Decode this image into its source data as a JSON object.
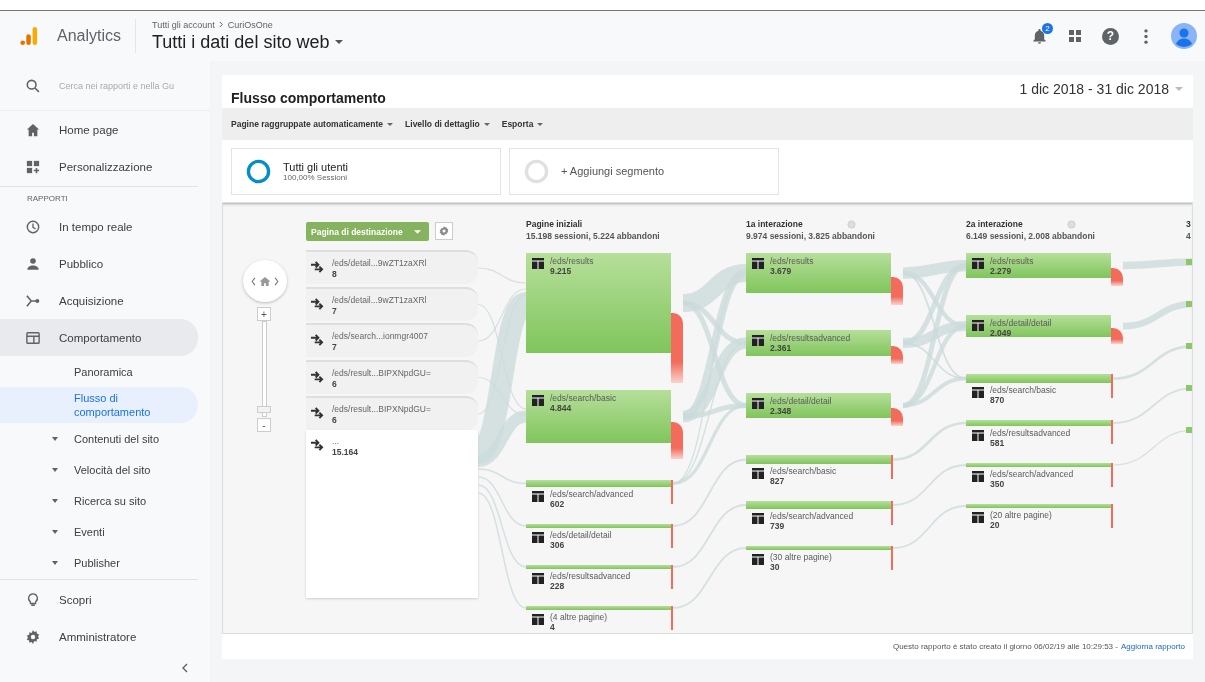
{
  "header": {
    "product": "Analytics",
    "breadcrumb": [
      "Tutti gli account",
      "CuriOsOne"
    ],
    "property": "Tutti i dati del sito web",
    "notifications": "2",
    "help": "?"
  },
  "sidebar": {
    "search_placeholder": "Cerca nei rapporti e nella Gu",
    "top_items": [
      {
        "label": "Home page"
      },
      {
        "label": "Personalizzazione"
      }
    ],
    "section": "RAPPORTI",
    "reports": [
      {
        "label": "In tempo reale",
        "expanded": false
      },
      {
        "label": "Pubblico",
        "expanded": false
      },
      {
        "label": "Acquisizione",
        "expanded": false
      },
      {
        "label": "Comportamento",
        "expanded": true,
        "children": [
          {
            "label": "Panoramica",
            "selected": false,
            "has_children": false
          },
          {
            "label": "Flusso di comportamento",
            "selected": true,
            "has_children": false
          },
          {
            "label": "Contenuti del sito",
            "selected": false,
            "has_children": true
          },
          {
            "label": "Velocità del sito",
            "selected": false,
            "has_children": true
          },
          {
            "label": "Ricerca su sito",
            "selected": false,
            "has_children": true
          },
          {
            "label": "Eventi",
            "selected": false,
            "has_children": true
          },
          {
            "label": "Publisher",
            "selected": false,
            "has_children": true
          }
        ]
      }
    ],
    "bottom_items": [
      {
        "label": "Scopri"
      },
      {
        "label": "Amministratore"
      }
    ]
  },
  "report": {
    "title": "Flusso comportamento",
    "date_range": "1 dic 2018 - 31 dic 2018",
    "toolbar": [
      "Pagine raggruppate automaticamente",
      "Livello di dettaglio",
      "Esporta"
    ],
    "segments": [
      {
        "kind": "segment",
        "title": "Tutti gli utenti",
        "subtitle": "100,00% Sessioni"
      },
      {
        "kind": "add",
        "title": "+ Aggiungi segmento"
      }
    ]
  },
  "flow": {
    "dimension": "Pagina di destinazione",
    "zoom": {
      "zoom_in": "+",
      "zoom_out": "-"
    },
    "landing_pages": [
      {
        "kind": "page",
        "label": "/eds/detail...9wZT1zaXRl",
        "count": "8"
      },
      {
        "kind": "page",
        "label": "/eds/detail...9wZT1zaXRl",
        "count": "7"
      },
      {
        "kind": "page",
        "label": "/eds/search...ionmgr4007",
        "count": "7"
      },
      {
        "kind": "page",
        "label": "/eds/result...BIPXNpdGU=",
        "count": "6"
      },
      {
        "kind": "page",
        "label": "/eds/result...BIPXNpdGU=",
        "count": "6"
      },
      {
        "kind": "more",
        "label": "...",
        "count": "15.164"
      }
    ],
    "columns": [
      {
        "title": "Pagine iniziali",
        "summary": "15.198 sessioni, 5.224 abbandoni",
        "info_icon": false,
        "nodes": [
          {
            "label": "/eds/results",
            "value": "9.215"
          },
          {
            "label": "/eds/search/basic",
            "value": "4.844"
          },
          {
            "label": "/eds/search/advanced",
            "value": "602"
          },
          {
            "label": "/eds/detail/detail",
            "value": "306"
          },
          {
            "label": "/eds/resultsadvanced",
            "value": "228"
          },
          {
            "label": "(4 altre pagine)",
            "value": "4"
          }
        ]
      },
      {
        "title": "1a interazione",
        "summary": "9.974 sessioni, 3.825 abbandoni",
        "info_icon": true,
        "nodes": [
          {
            "label": "/eds/results",
            "value": "3.679"
          },
          {
            "label": "/eds/resultsadvanced",
            "value": "2.361"
          },
          {
            "label": "/eds/detail/detail",
            "value": "2.348"
          },
          {
            "label": "/eds/search/basic",
            "value": "827"
          },
          {
            "label": "/eds/search/advanced",
            "value": "739"
          },
          {
            "label": "(30 altre pagine)",
            "value": "30"
          }
        ]
      },
      {
        "title": "2a interazione",
        "summary": "6.149 sessioni, 2.008 abbandoni",
        "info_icon": true,
        "nodes": [
          {
            "label": "/eds/results",
            "value": "2.279"
          },
          {
            "label": "/eds/detail/detail",
            "value": "2.049"
          },
          {
            "label": "/eds/search/basic",
            "value": "870"
          },
          {
            "label": "/eds/resultsadvanced",
            "value": "581"
          },
          {
            "label": "/eds/search/advanced",
            "value": "350"
          },
          {
            "label": "(20 altre pagine)",
            "value": "20"
          }
        ]
      },
      {
        "title": "3",
        "summary": "4",
        "info_icon": false
      }
    ]
  },
  "footer": {
    "text": "Questo rapporto è stato creato il giorno 06/02/19 alle 10:29:53 -",
    "link": "Aggiorna rapporto"
  }
}
